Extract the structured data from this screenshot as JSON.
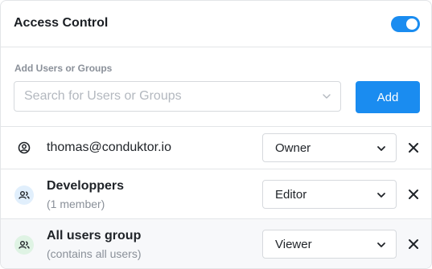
{
  "panel": {
    "title": "Access Control",
    "toggle_on": true,
    "accent_color": "#1a8cf0"
  },
  "add_section": {
    "label": "Add Users or Groups",
    "search_placeholder": "Search for Users or Groups",
    "search_value": "",
    "add_button_label": "Add"
  },
  "members": [
    {
      "type": "user",
      "icon": "user-circle-icon",
      "name": "thomas@conduktor.io",
      "subtitle": "",
      "role": "Owner"
    },
    {
      "type": "group",
      "icon": "group-icon",
      "name": "Developpers",
      "subtitle": "(1 member)",
      "role": "Editor"
    },
    {
      "type": "group",
      "icon": "group-icon",
      "name": "All users group",
      "subtitle": "(contains all users)",
      "role": "Viewer"
    }
  ]
}
